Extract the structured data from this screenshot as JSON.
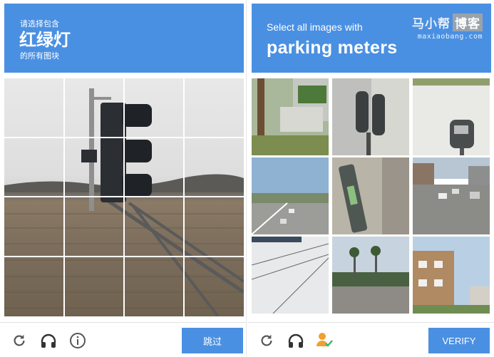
{
  "left_captcha": {
    "instruction_line1": "请选择包含",
    "target": "红绿灯",
    "instruction_line2": "的所有图块",
    "skip_label": "跳过",
    "grid": {
      "rows": 4,
      "cols": 4
    }
  },
  "right_captcha": {
    "instruction": "Select all images with",
    "target": "parking meters",
    "verify_label": "VERIFY",
    "tiles": [
      {
        "label": "stairs-and-pole"
      },
      {
        "label": "parking-meter-closeup"
      },
      {
        "label": "parking-meter-wall"
      },
      {
        "label": "highway-cars"
      },
      {
        "label": "parking-meter-tilted"
      },
      {
        "label": "street-cars"
      },
      {
        "label": "sky-wires"
      },
      {
        "label": "palm-trees-road"
      },
      {
        "label": "apartment-building"
      }
    ]
  },
  "watermark": {
    "name_part1": "马小帮",
    "name_part2": "博客",
    "url": "maxiaobang.com"
  },
  "colors": {
    "accent": "#4a90e2",
    "check": "#3cb371",
    "person": "#f0a030"
  },
  "icons": [
    "refresh-icon",
    "headphones-icon",
    "info-icon",
    "person-check-icon"
  ]
}
